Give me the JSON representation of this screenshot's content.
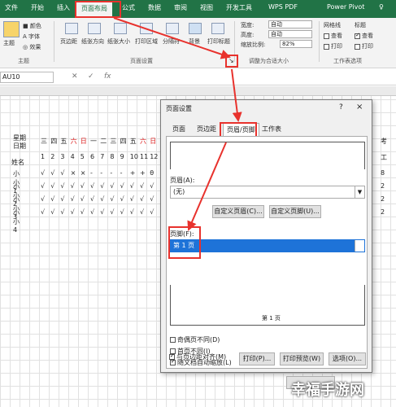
{
  "ribbon_tabs": [
    "文件",
    "开始",
    "插入",
    "页面布局",
    "公式",
    "数据",
    "审阅",
    "视图",
    "开发工具",
    "WPS PDF",
    "Power Pivot"
  ],
  "active_tab": "页面布局",
  "ribbon": {
    "theme_group": {
      "main": "主题",
      "colors": "颜色",
      "fonts": "字体",
      "effects": "效果",
      "label": "主题"
    },
    "page_setup_items": [
      "页边距",
      "纸张方向",
      "纸张大小",
      "打印区域",
      "分隔符",
      "背景",
      "打印标题"
    ],
    "page_setup_label": "页面设置",
    "scale_group": {
      "width": "宽度:",
      "width_val": "自动",
      "height": "高度:",
      "height_val": "自动",
      "scale": "缩放比例:",
      "scale_val": "82%",
      "label": "调整为合适大小"
    },
    "sheet_options": {
      "gridlines": "网格线",
      "headings": "标题",
      "view": "查看",
      "print": "打印",
      "label": "工作表选项"
    }
  },
  "formula_bar": {
    "name_box": "AU10",
    "fx": "fx"
  },
  "sheet": {
    "header_corner_top": "星期",
    "header_corner_bottom": "日期",
    "name_header": "姓名",
    "weekdays": [
      "三",
      "四",
      "五",
      "六",
      "日",
      "一",
      "二",
      "三",
      "四",
      "五",
      "六",
      "日"
    ],
    "day_numbers": [
      "1",
      "2",
      "3",
      "4",
      "5",
      "6",
      "7",
      "8",
      "9",
      "10",
      "11",
      "12"
    ],
    "rows": [
      {
        "name": "小小1",
        "marks": [
          "√",
          "√",
          "√",
          "×",
          "×",
          "-",
          "-",
          "-",
          "-",
          "+",
          "+",
          "θ"
        ]
      },
      {
        "name": "小小2",
        "marks": [
          "√",
          "√",
          "√",
          "√",
          "√",
          "√",
          "√",
          "√",
          "√",
          "√",
          "√",
          "√"
        ]
      },
      {
        "name": "小小3",
        "marks": [
          "√",
          "√",
          "√",
          "√",
          "√",
          "√",
          "√",
          "√",
          "√",
          "√",
          "√",
          "√"
        ]
      },
      {
        "name": "小小4",
        "marks": [
          "√",
          "√",
          "√",
          "√",
          "√",
          "√",
          "√",
          "√",
          "√",
          "√",
          "√",
          "√"
        ]
      }
    ],
    "right_col_head": [
      "考",
      "工"
    ],
    "right_col_vals": [
      "8",
      "2",
      "2",
      "2"
    ]
  },
  "dialog": {
    "title": "页面设置",
    "help": "?",
    "close": "×",
    "tabs": [
      "页面",
      "页边距",
      "页眉/页脚",
      "工作表"
    ],
    "active_tab": "页眉/页脚",
    "header_label": "页眉(A):",
    "header_value": "(无)",
    "custom_header": "自定义页眉(C)...",
    "custom_footer": "自定义页脚(U)...",
    "footer_label": "页脚(F):",
    "footer_value": "第 1 页",
    "preview_text": "第 1 页",
    "checkboxes": [
      {
        "label": "奇偶页不同(D)",
        "checked": false
      },
      {
        "label": "首页不同(I)",
        "checked": false
      },
      {
        "label": "随文档自动缩放(L)",
        "checked": true
      },
      {
        "label": "与页边距对齐(M)",
        "checked": true
      }
    ],
    "print_btn": "打印(P)...",
    "preview_btn": "打印预览(W)",
    "options_btn": "选项(O)..."
  },
  "watermark": "幸福手游网",
  "colors": {
    "excel_green": "#217346",
    "highlight_red": "#e8322d",
    "selection_blue": "#1e73d8"
  }
}
